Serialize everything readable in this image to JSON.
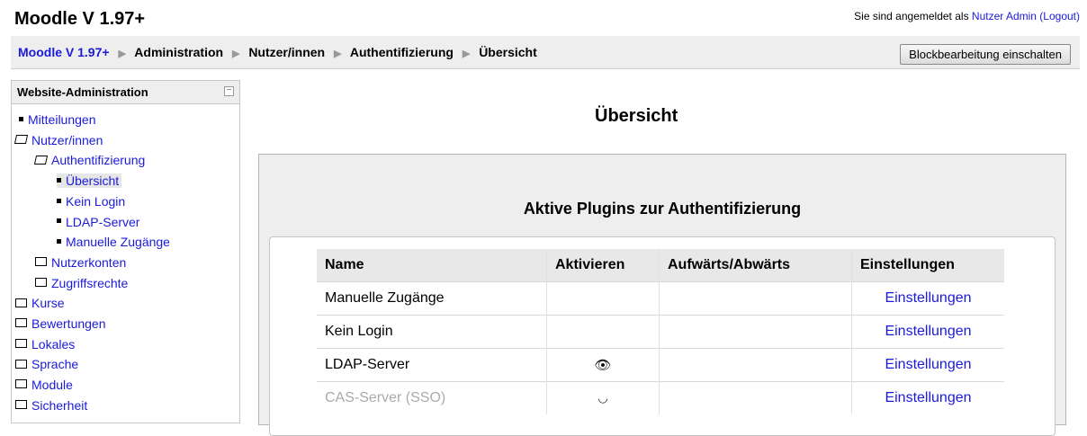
{
  "header": {
    "site_title": "Moodle V 1.97+",
    "login_prefix": "Sie sind angemeldet als",
    "user_name": "Nutzer Admin",
    "logout_label": "(Logout)"
  },
  "breadcrumb": {
    "items": [
      "Moodle V 1.97+",
      "Administration",
      "Nutzer/innen",
      "Authentifizierung",
      "Übersicht"
    ]
  },
  "toolbar": {
    "block_edit_label": "Blockbearbeitung einschalten"
  },
  "sidebar": {
    "title": "Website-Administration",
    "items": [
      {
        "label": "Mitteilungen"
      },
      {
        "label": "Nutzer/innen"
      },
      {
        "label": "Authentifizierung"
      },
      {
        "label": "Übersicht"
      },
      {
        "label": "Kein Login"
      },
      {
        "label": "LDAP-Server"
      },
      {
        "label": "Manuelle Zugänge"
      },
      {
        "label": "Nutzerkonten"
      },
      {
        "label": "Zugriffsrechte"
      },
      {
        "label": "Kurse"
      },
      {
        "label": "Bewertungen"
      },
      {
        "label": "Lokales"
      },
      {
        "label": "Sprache"
      },
      {
        "label": "Module"
      },
      {
        "label": "Sicherheit"
      }
    ]
  },
  "main": {
    "heading": "Übersicht",
    "section_heading": "Aktive Plugins zur Authentifizierung",
    "table": {
      "headers": [
        "Name",
        "Aktivieren",
        "Aufwärts/Abwärts",
        "Einstellungen"
      ],
      "rows": [
        {
          "name": "Manuelle Zugänge",
          "settings": "Einstellungen"
        },
        {
          "name": "Kein Login",
          "settings": "Einstellungen"
        },
        {
          "name": "LDAP-Server",
          "settings": "Einstellungen"
        },
        {
          "name": "CAS-Server (SSO)",
          "settings": "Einstellungen"
        }
      ]
    }
  }
}
